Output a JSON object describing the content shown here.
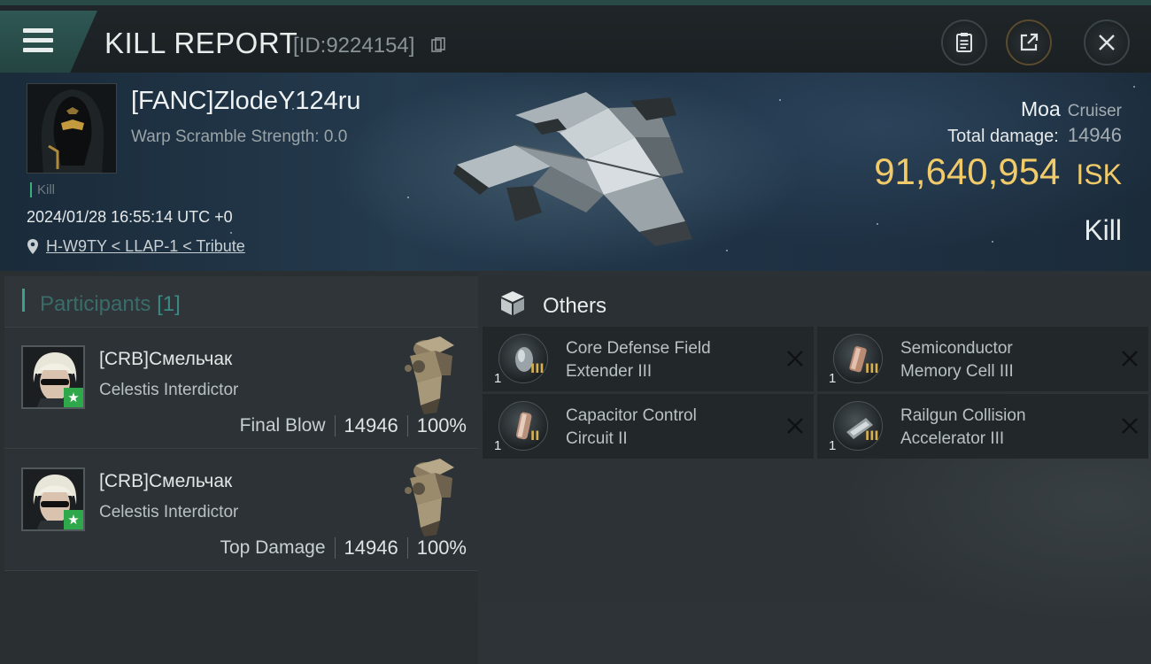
{
  "header": {
    "title": "KILL REPORT",
    "report_id": "[ID:9224154]",
    "menu_icon": "hamburger-menu-icon",
    "buttons": [
      "clipboard-icon",
      "share-icon",
      "close-icon"
    ]
  },
  "victim": {
    "name": "[FANC]ZlodeY124ru",
    "scramble": "Warp Scramble Strength: 0.0",
    "tag": "Kill",
    "datetime": "2024/01/28 16:55:14 UTC +0",
    "location": "H-W9TY < LLAP-1 < Tribute"
  },
  "ship": {
    "name": "Moa",
    "class": "Cruiser",
    "damage_label": "Total damage:",
    "damage_value": "14946",
    "isk_value": "91,640,954",
    "isk_unit": "ISK",
    "result": "Kill"
  },
  "participants": {
    "title": "Participants",
    "count": "[1]",
    "items": [
      {
        "name": "[CRB]Смельчак",
        "ship": "Celestis Interdictor",
        "role": "Final Blow",
        "damage": "14946",
        "percent": "100%"
      },
      {
        "name": "[CRB]Смельчак",
        "ship": "Celestis Interdictor",
        "role": "Top Damage",
        "damage": "14946",
        "percent": "100%"
      }
    ]
  },
  "others": {
    "title": "Others",
    "items": [
      {
        "name_line1": "Core Defense Field",
        "name_line2": "Extender III",
        "qty": "1",
        "tier": "III"
      },
      {
        "name_line1": "Semiconductor",
        "name_line2": "Memory Cell III",
        "qty": "1",
        "tier": "III"
      },
      {
        "name_line1": "Capacitor Control",
        "name_line2": "Circuit II",
        "qty": "1",
        "tier": "II"
      },
      {
        "name_line1": "Railgun Collision",
        "name_line2": "Accelerator III",
        "qty": "1",
        "tier": "III"
      }
    ]
  },
  "colors": {
    "accent_teal": "#3aa08f",
    "isk_gold": "#f1cb6a",
    "star_badge_green": "#2ea84a"
  }
}
